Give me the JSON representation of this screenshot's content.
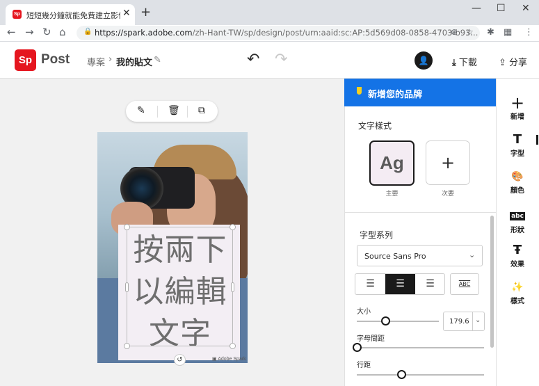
{
  "browser": {
    "tab_title": "短短幾分鐘就能免費建立影像 - I",
    "tab_favicon": "Sp",
    "tab_close": "✕",
    "new_tab": "+",
    "url_host": "https://spark.adobe.com",
    "url_path": "/zh-Hant-TW/sp/design/post/urn:aaid:sc:AP:5d569d08-0858-4703-b93...",
    "window_min": "—",
    "window_max": "☐",
    "window_close": "✕"
  },
  "app": {
    "logo": "Sp",
    "name": "Post",
    "breadcrumb_parent": "專案",
    "breadcrumb_sep": "›",
    "breadcrumb_current": "我的貼文",
    "download_label": "下載",
    "share_label": "分享"
  },
  "poster": {
    "text_lines": [
      "按兩下",
      "以編輯",
      "文字"
    ],
    "watermark": "Adobe Spark"
  },
  "panel": {
    "brand_banner": "新增您的品牌",
    "text_style_header": "文字樣式",
    "style_primary_sample": "Ag",
    "style_primary_label": "主要",
    "style_secondary_sample": "+",
    "style_secondary_label": "次要",
    "font_family_header": "字型系列",
    "font_family_value": "Source Sans Pro",
    "size_label": "大小",
    "size_value": "179.6",
    "tracking_label": "字母間距",
    "leading_label": "行距",
    "size_level": 0.35,
    "tracking_level": 0.0,
    "leading_level": 0.35
  },
  "rail": {
    "items": [
      {
        "icon": "+",
        "label": "新增"
      },
      {
        "icon": "T",
        "label": "字型"
      },
      {
        "icon": "🎨",
        "label": "顏色"
      },
      {
        "icon": "abc",
        "label": "形狀"
      },
      {
        "icon": "Ŧ",
        "label": "效果"
      },
      {
        "icon": "✨",
        "label": "樣式"
      }
    ]
  }
}
